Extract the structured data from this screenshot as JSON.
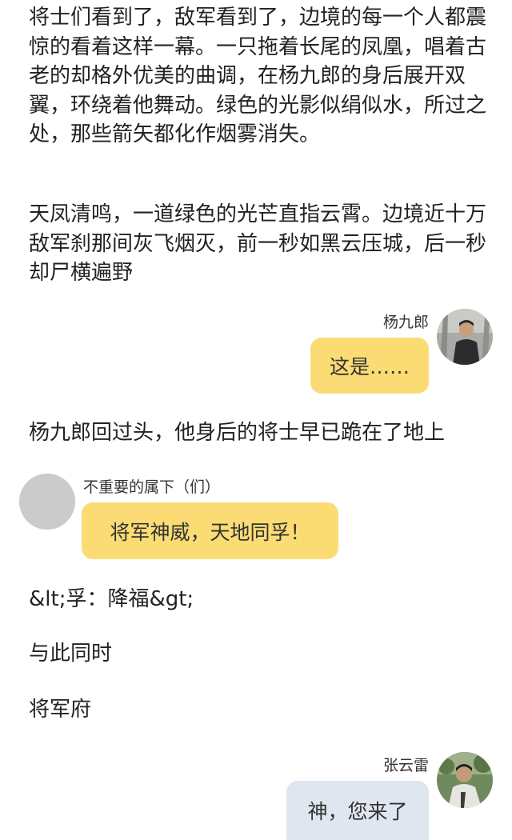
{
  "story": {
    "para1": "将士们看到了，敌军看到了，边境的每一个人都震惊的看着这样一幕。一只拖着长尾的凤凰，唱着古老的却格外优美的曲调，在杨九郎的身后展开双翼，环绕着他舞动。绿色的光影似绢似水，所过之处，那些箭矢都化作烟雾消失。",
    "para2": "天凤清鸣，一道绿色的光芒直指云霄。边境近十万敌军刹那间灰飞烟灭，前一秒如黑云压城，后一秒却尸横遍野",
    "para3": "杨九郎回过头，他身后的将士早已跪在了地上",
    "para4": "&lt;孚：降福&gt;",
    "para5": "与此同时",
    "para6": "将军府"
  },
  "chat": [
    {
      "speaker": "杨九郎",
      "text": "这是……",
      "side": "right",
      "bubble_color": "#fbdc74",
      "avatar": "photo-avatar-man"
    },
    {
      "speaker": "不重要的属下（们）",
      "text": "将军神威，天地同孚！",
      "side": "left",
      "bubble_color": "#fbdc74",
      "avatar": "placeholder-avatar"
    },
    {
      "speaker": "张云雷",
      "text": "神，您来了",
      "side": "right",
      "bubble_color": "#dfe6f0",
      "avatar": "photo-avatar-man-outdoor"
    }
  ]
}
